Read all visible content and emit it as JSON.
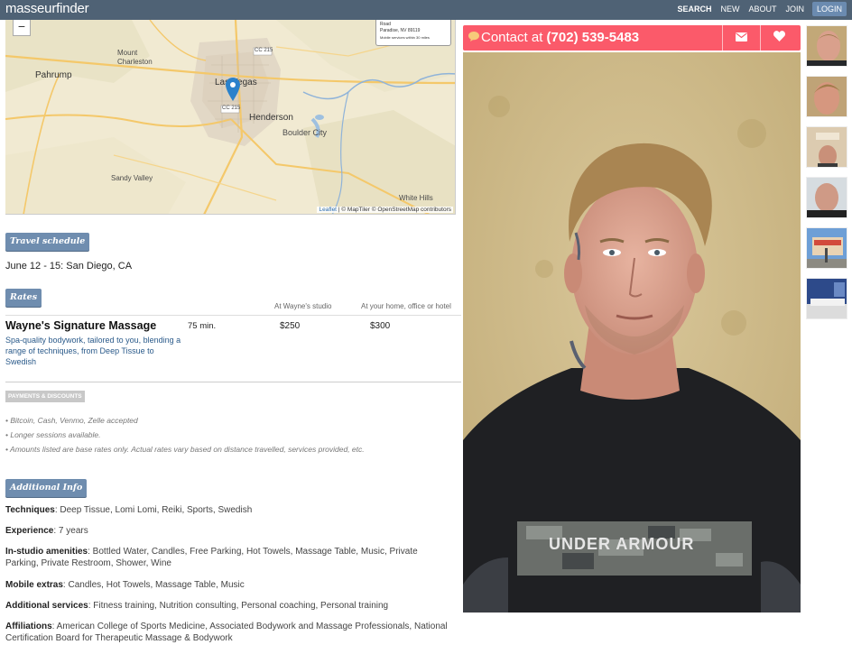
{
  "header": {
    "logo": "masseurfinder",
    "nav": [
      "SEARCH",
      "NEW",
      "ABOUT",
      "JOIN",
      "LOGIN"
    ]
  },
  "map": {
    "zoom_out": "−",
    "popup_lines": [
      "Road",
      "Paradise, NV 89119",
      "Mobile services within 30 miles"
    ],
    "labels": [
      "Mount Charleston",
      "Pahrump",
      "Las Vegas",
      "Henderson",
      "Boulder City",
      "Sandy Valley",
      "White Hills",
      "CC 215",
      "CC 215",
      "CC 215"
    ],
    "attribution_leaflet": "Leaflet",
    "attribution_rest": "| © MapTiler © OpenStreetMap contributors"
  },
  "travel": {
    "heading": "Travel schedule",
    "entry": "June 12 - 15: San Diego, CA"
  },
  "rates": {
    "heading": "Rates",
    "col_studio": "At Wayne's studio",
    "col_home": "At your home, office or hotel",
    "service_name": "Wayne's Signature Massage",
    "service_desc": "Spa-quality bodywork, tailored to you, blending a range of techniques, from Deep Tissue to Swedish",
    "duration": "75 min.",
    "studio_price": "$250",
    "home_price": "$300"
  },
  "payments": {
    "heading": "PAYMENTS & DISCOUNTS",
    "notes": [
      "• Bitcoin, Cash, Venmo, Zelle accepted",
      "• Longer sessions available.",
      "• Amounts listed are base rates only. Actual rates vary based on distance travelled, services provided, etc."
    ]
  },
  "additional": {
    "heading": "Additional Info",
    "items": [
      {
        "label": "Techniques",
        "value": ": Deep Tissue, Lomi Lomi, Reiki, Sports, Swedish"
      },
      {
        "label": "Experience",
        "value": ": 7 years"
      },
      {
        "label": "In-studio amenities",
        "value": ": Bottled Water, Candles, Free Parking, Hot Towels, Massage Table, Music, Private Parking, Private Restroom, Shower, Wine"
      },
      {
        "label": "Mobile extras",
        "value": ": Candles, Hot Towels, Massage Table, Music"
      },
      {
        "label": "Additional services",
        "value": ": Fitness training, Nutrition consulting, Personal coaching, Personal training"
      },
      {
        "label": "Affiliations",
        "value": ": American College of Sports Medicine, Associated Bodywork and Massage Professionals, National Certification Board for Therapeutic Massage & Bodywork"
      }
    ]
  },
  "contact": {
    "prefix": "Contact at",
    "phone": "(702) 539-5483",
    "email_icon": "envelope-icon",
    "favorite_icon": "heart-icon",
    "chat_icon": "chat-bubble-icon"
  },
  "photo": {
    "shirt_text": "UNDER ARMOUR"
  },
  "colors": {
    "topbar": "#4f6275",
    "accent": "#fb5a6a",
    "tag": "#6f8daf"
  }
}
